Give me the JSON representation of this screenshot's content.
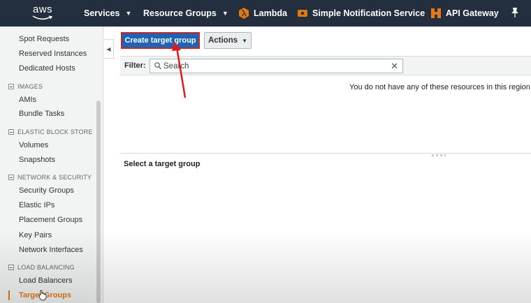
{
  "topnav": {
    "logo_text": "aws",
    "services_label": "Services",
    "resource_groups_label": "Resource Groups",
    "shortcuts": [
      {
        "label": "Lambda",
        "icon": "lambda-icon"
      },
      {
        "label": "Simple Notification Service",
        "icon": "sns-icon"
      },
      {
        "label": "API Gateway",
        "icon": "api-gateway-icon"
      }
    ],
    "pin_icon": "pin-icon",
    "colors": {
      "bar": "#232f3e",
      "service_icon": "#e47911"
    }
  },
  "sidebar": {
    "items": {
      "spot_requests": "Spot Requests",
      "reserved_instances": "Reserved Instances",
      "dedicated_hosts": "Dedicated Hosts",
      "amis": "AMIs",
      "bundle_tasks": "Bundle Tasks",
      "volumes": "Volumes",
      "snapshots": "Snapshots",
      "security_groups": "Security Groups",
      "elastic_ips": "Elastic IPs",
      "placement_groups": "Placement Groups",
      "key_pairs": "Key Pairs",
      "network_interfaces": "Network Interfaces",
      "load_balancers": "Load Balancers",
      "target_groups": "Target Groups"
    },
    "sections": {
      "images": "IMAGES",
      "ebs": "ELASTIC BLOCK STORE",
      "network": "NETWORK & SECURITY",
      "load_balancing": "LOAD BALANCING"
    },
    "active_item": "Target Groups",
    "active_color": "#e47911"
  },
  "toolbar": {
    "create_label": "Create target group",
    "actions_label": "Actions",
    "primary_color": "#1e64b5",
    "highlight_color": "#c62828"
  },
  "filter": {
    "label": "Filter:",
    "placeholder": "Search"
  },
  "table": {
    "empty_message": "You do not have any of these resources in this region."
  },
  "details": {
    "title": "Select a target group"
  }
}
